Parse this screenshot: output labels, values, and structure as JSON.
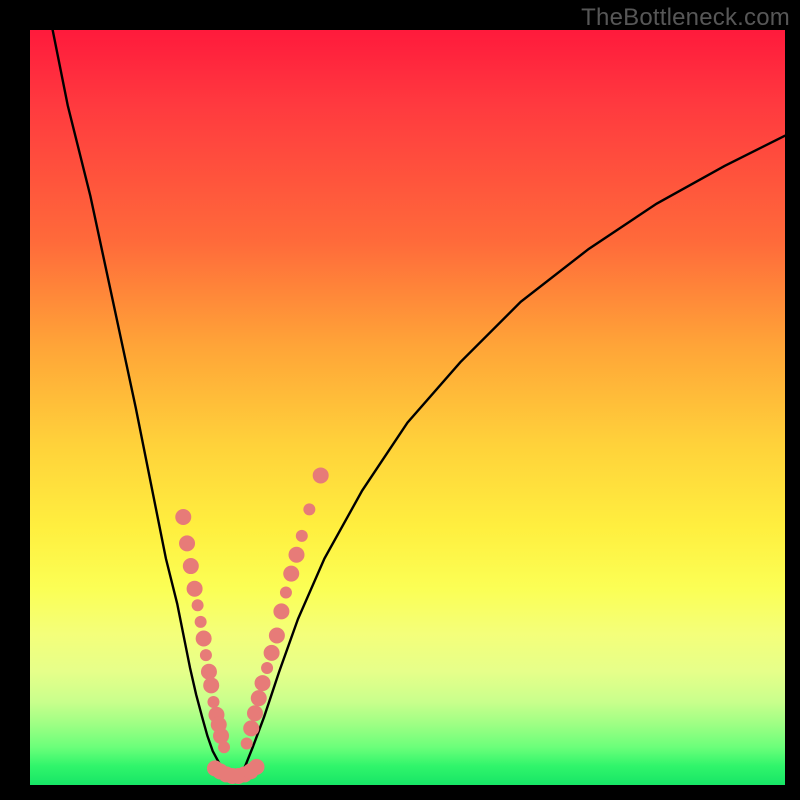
{
  "watermark": "TheBottleneck.com",
  "chart_data": {
    "type": "line",
    "title": "",
    "xlabel": "",
    "ylabel": "",
    "xlim": [
      0,
      100
    ],
    "ylim": [
      0,
      100
    ],
    "grid": false,
    "legend": false,
    "series": [
      {
        "name": "left-curve",
        "color": "#000000",
        "x": [
          3,
          5,
          8,
          11,
          14,
          16,
          18,
          19.5,
          20.5,
          21.2,
          22,
          22.8,
          23.5,
          24.2,
          25,
          25.8,
          26.5
        ],
        "y": [
          100,
          90,
          78,
          64,
          50,
          40,
          30,
          24,
          19,
          15.5,
          12,
          9,
          6.5,
          4.5,
          3,
          1.8,
          1
        ]
      },
      {
        "name": "right-curve",
        "color": "#000000",
        "x": [
          27.5,
          28.5,
          29.5,
          31,
          33,
          35.5,
          39,
          44,
          50,
          57,
          65,
          74,
          83,
          92,
          100
        ],
        "y": [
          1,
          2.5,
          5,
          9,
          15,
          22,
          30,
          39,
          48,
          56,
          64,
          71,
          77,
          82,
          86
        ]
      }
    ],
    "scatter": {
      "name": "sample-points",
      "color": "#e77b78",
      "radius_major": 8,
      "radius_minor": 6,
      "points": [
        {
          "x": 20.3,
          "y": 35.5,
          "r": "major"
        },
        {
          "x": 20.8,
          "y": 32.0,
          "r": "major"
        },
        {
          "x": 21.3,
          "y": 29.0,
          "r": "major"
        },
        {
          "x": 21.8,
          "y": 26.0,
          "r": "major"
        },
        {
          "x": 22.2,
          "y": 23.8,
          "r": "minor"
        },
        {
          "x": 22.6,
          "y": 21.6,
          "r": "minor"
        },
        {
          "x": 23.0,
          "y": 19.4,
          "r": "major"
        },
        {
          "x": 23.3,
          "y": 17.2,
          "r": "minor"
        },
        {
          "x": 23.7,
          "y": 15.0,
          "r": "major"
        },
        {
          "x": 24.0,
          "y": 13.2,
          "r": "major"
        },
        {
          "x": 24.3,
          "y": 11.0,
          "r": "minor"
        },
        {
          "x": 24.7,
          "y": 9.3,
          "r": "major"
        },
        {
          "x": 25.0,
          "y": 8.0,
          "r": "major"
        },
        {
          "x": 25.3,
          "y": 6.5,
          "r": "major"
        },
        {
          "x": 25.7,
          "y": 5.0,
          "r": "minor"
        },
        {
          "x": 24.5,
          "y": 2.2,
          "r": "major"
        },
        {
          "x": 25.2,
          "y": 1.8,
          "r": "major"
        },
        {
          "x": 26.0,
          "y": 1.4,
          "r": "major"
        },
        {
          "x": 26.8,
          "y": 1.2,
          "r": "major"
        },
        {
          "x": 27.6,
          "y": 1.2,
          "r": "major"
        },
        {
          "x": 28.4,
          "y": 1.4,
          "r": "major"
        },
        {
          "x": 29.2,
          "y": 1.8,
          "r": "major"
        },
        {
          "x": 30.0,
          "y": 2.4,
          "r": "major"
        },
        {
          "x": 28.7,
          "y": 5.5,
          "r": "minor"
        },
        {
          "x": 29.3,
          "y": 7.5,
          "r": "major"
        },
        {
          "x": 29.8,
          "y": 9.5,
          "r": "major"
        },
        {
          "x": 30.3,
          "y": 11.5,
          "r": "major"
        },
        {
          "x": 30.8,
          "y": 13.5,
          "r": "major"
        },
        {
          "x": 31.4,
          "y": 15.5,
          "r": "minor"
        },
        {
          "x": 32.0,
          "y": 17.5,
          "r": "major"
        },
        {
          "x": 32.7,
          "y": 19.8,
          "r": "major"
        },
        {
          "x": 33.3,
          "y": 23.0,
          "r": "major"
        },
        {
          "x": 33.9,
          "y": 25.5,
          "r": "minor"
        },
        {
          "x": 34.6,
          "y": 28.0,
          "r": "major"
        },
        {
          "x": 35.3,
          "y": 30.5,
          "r": "major"
        },
        {
          "x": 36.0,
          "y": 33.0,
          "r": "minor"
        },
        {
          "x": 37.0,
          "y": 36.5,
          "r": "minor"
        },
        {
          "x": 38.5,
          "y": 41.0,
          "r": "major"
        }
      ]
    }
  }
}
